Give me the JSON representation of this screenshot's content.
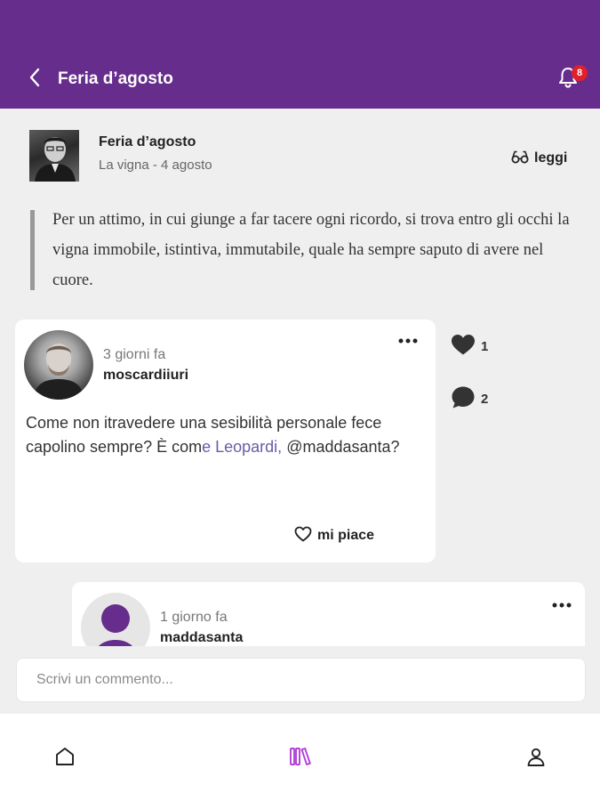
{
  "header": {
    "title": "Feria d’agosto",
    "notification_count": "8",
    "background_color": "#662d8c"
  },
  "book": {
    "title": "Feria d’agosto",
    "subtitle": "La vigna - 4 agosto",
    "read_label": "leggi"
  },
  "quote": {
    "text": "Per un attimo, in cui giunge a far tacere ogni ricordo, si trova entro gli occhi la vigna immobile, istintiva, immutabile, quale ha sempre saputo di avere nel cuore."
  },
  "comments": [
    {
      "time": "3 giorni fa",
      "user": "moscardiiuri",
      "text_part1": "Come non itravedere una sesibilità personale fece capolino sempre? È com",
      "text_mention": "e Leopardi,",
      "text_part2": " @maddasanta?",
      "like_label": "mi piace",
      "likes_count": "1",
      "replies_count": "2"
    },
    {
      "time": "1 giorno fa",
      "user": "maddasanta"
    }
  ],
  "comment_input": {
    "placeholder": "Scrivi un commento..."
  },
  "nav": {
    "items": [
      "home",
      "library",
      "profile"
    ],
    "active": "library",
    "active_color": "#b23fd8"
  },
  "icons": {
    "back": "chevron-left-icon",
    "bell": "bell-icon",
    "read": "glasses-icon",
    "more": "more-horizontal-icon",
    "heart": "heart-icon",
    "comment": "speech-bubble-icon"
  }
}
